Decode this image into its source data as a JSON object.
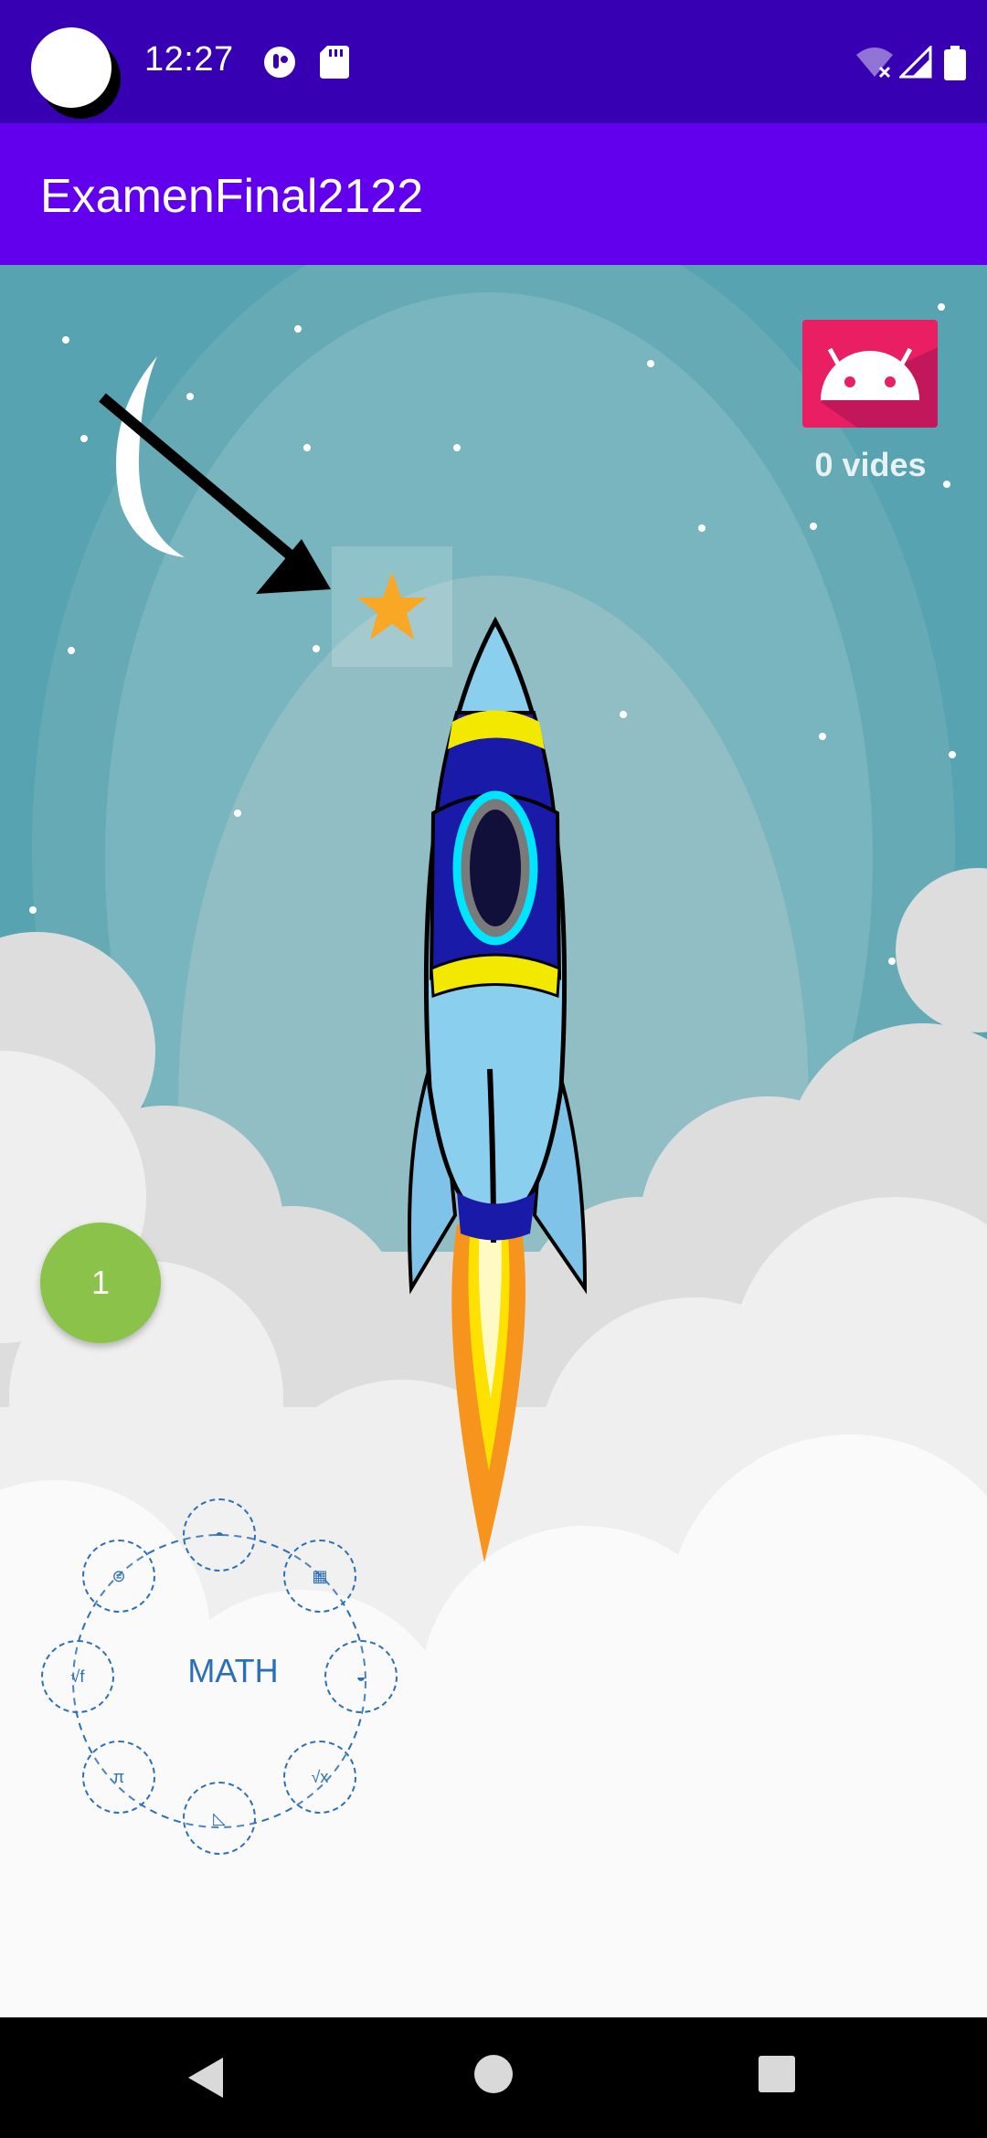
{
  "status_bar": {
    "time": "12:27"
  },
  "app_bar": {
    "title": "ExamenFinal2122"
  },
  "game": {
    "lives_label": "0 vides",
    "counter": "1",
    "math_menu": {
      "center_label": "MATH",
      "items": [
        {
          "name": "protractor"
        },
        {
          "name": "calculator"
        },
        {
          "name": "half-circle"
        },
        {
          "name": "square-root-x"
        },
        {
          "name": "set-square"
        },
        {
          "name": "pi-symbol"
        },
        {
          "name": "root-function"
        },
        {
          "name": "equals"
        }
      ]
    }
  },
  "colors": {
    "status_bar": "#3700B3",
    "app_bar": "#6200EE",
    "badge": "#E91E63",
    "counter": "#8BC34A",
    "math": "#2A6FB8"
  }
}
